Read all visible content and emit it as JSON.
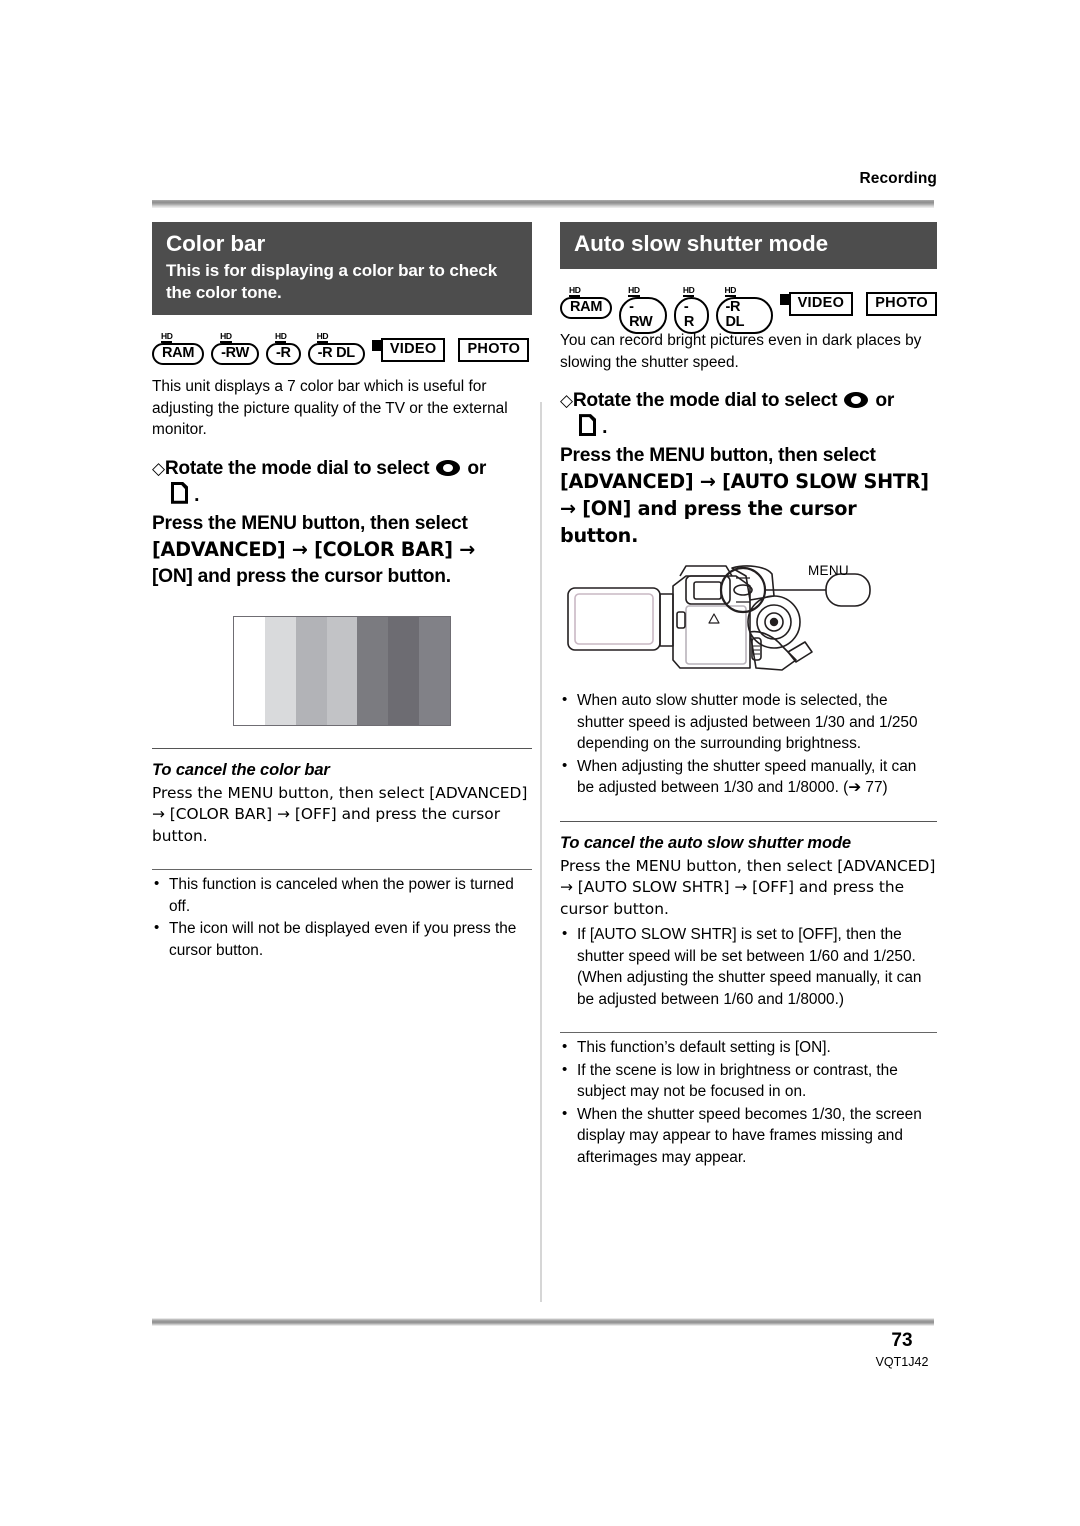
{
  "header": {
    "section_label": "Recording"
  },
  "footer": {
    "page_number": "73",
    "document_code": "VQT1J42"
  },
  "media_icons": [
    {
      "hd": "HD",
      "label": "RAM",
      "type": "pill"
    },
    {
      "hd": "HD",
      "label": "-RW",
      "type": "pill"
    },
    {
      "hd": "HD",
      "label": "-R",
      "type": "pill"
    },
    {
      "hd": "HD",
      "label": "-R DL",
      "type": "pill"
    },
    {
      "label": "VIDEO",
      "type": "flag"
    },
    {
      "label": "PHOTO",
      "type": "plain"
    }
  ],
  "left_column": {
    "title": "Color bar",
    "subtitle": "This is for displaying a color bar to check the color tone.",
    "intro": "This unit displays a 7 color bar which is useful for adjusting the picture quality of the TV or the external monitor.",
    "step_dial": "Rotate the mode dial to select",
    "step_dial_or": "or",
    "step_dial_end": ".",
    "step_menu_line1": "Press the MENU button, then select",
    "step_menu_line2": "[ADVANCED] → [COLOR BAR] →",
    "step_menu_line3": "[ON] and press the cursor button.",
    "cancel_heading": "To cancel the color bar",
    "cancel_body": "Press the MENU button, then select [ADVANCED] → [COLOR BAR] → [OFF] and press the cursor button.",
    "notes": [
      "This function is canceled when the power is turned off.",
      "The icon will not be displayed even if you press the cursor button."
    ]
  },
  "right_column": {
    "title": "Auto slow shutter mode",
    "intro": "You can record bright pictures even in dark places by slowing the shutter speed.",
    "step_dial": "Rotate the mode dial to select",
    "step_dial_or": "or",
    "step_dial_end": ".",
    "step_menu_line1": "Press the MENU button, then select",
    "step_menu_line2": "[ADVANCED] → [AUTO SLOW SHTR]",
    "step_menu_line3": "→ [ON] and press the cursor button.",
    "figure": {
      "callout_label": "MENU"
    },
    "notes_top": [
      "When auto slow shutter mode is selected, the shutter speed is adjusted between 1/30 and 1/250 depending on the surrounding brightness.",
      "When adjusting the shutter speed manually, it can be adjusted between 1/30 and 1/8000. (➔ 77)"
    ],
    "cancel_heading": "To cancel the auto slow shutter mode",
    "cancel_body": "Press the MENU button, then select [ADVANCED] → [AUTO SLOW SHTR] → [OFF] and press the cursor button.",
    "cancel_note": "If [AUTO SLOW SHTR] is set to [OFF], then the  shutter speed will be set between 1/60 and 1/250. (When adjusting the shutter speed manually, it can be adjusted between 1/60 and 1/8000.)",
    "notes_bottom": [
      "This function’s default setting is [ON].",
      "If the scene is low in brightness or contrast, the subject may not be focused in on.",
      "When the shutter speed becomes 1/30, the screen display may appear to have frames missing and afterimages may appear."
    ]
  },
  "color_bar_figure": {
    "segment_count": 7,
    "segments": [
      "#ffffff",
      "#d9dadc",
      "#b2b3b7",
      "#c2c3c6",
      "#7b7b80",
      "#6d6c72",
      "#818187"
    ],
    "border": "#6f6d73"
  },
  "colors": {
    "banner_bg": "#4d4d4d",
    "banner_text": "#ffffff",
    "body_text": "#000000",
    "divider": "#d6d6d6"
  }
}
